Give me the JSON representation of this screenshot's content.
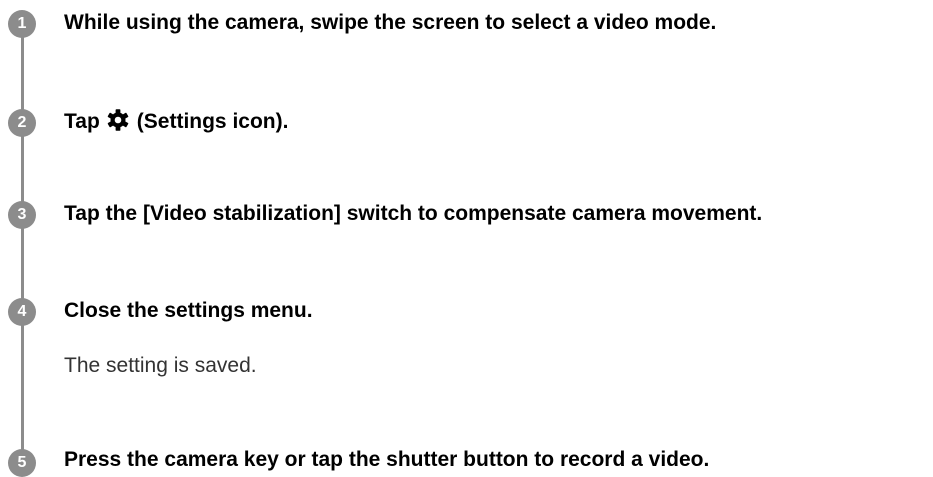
{
  "steps": [
    {
      "number": "1",
      "instruction": "While using the camera, swipe the screen to select a video mode."
    },
    {
      "number": "2",
      "instruction_before_icon": "Tap",
      "icon": "gear-icon",
      "instruction_after_icon": "(Settings icon)."
    },
    {
      "number": "3",
      "instruction": "Tap the [Video stabilization] switch to compensate camera movement."
    },
    {
      "number": "4",
      "instruction": "Close the settings menu.",
      "result": "The setting is saved."
    },
    {
      "number": "5",
      "instruction": "Press the camera key or tap the shutter button to record a video."
    }
  ],
  "colors": {
    "step_circle": "#8c8c8c",
    "step_number_text": "#ffffff",
    "instruction_text": "#000000",
    "result_text": "#333333"
  }
}
